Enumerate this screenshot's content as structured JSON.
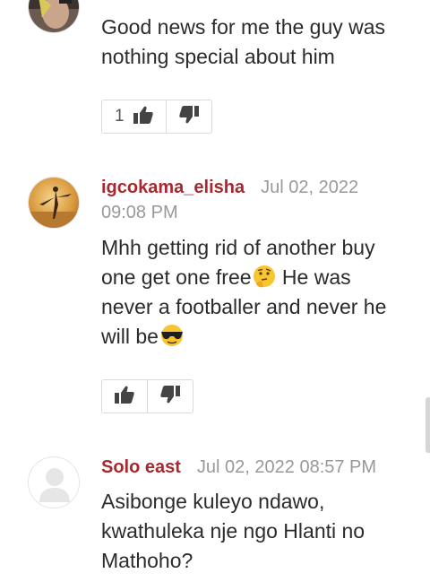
{
  "comments": [
    {
      "body": "Good news for me the guy was nothing special about him",
      "upvotes": "1"
    },
    {
      "username": "igcokama_elisha",
      "timestamp": "Jul 02, 2022 09:08 PM",
      "body_part1": "Mhh getting rid of another buy one get one free",
      "body_part2": " He was never a footballer and never he will be",
      "emoji1": "thinking-face",
      "emoji2": "sunglasses-face",
      "upvotes": ""
    },
    {
      "username": "Solo east",
      "timestamp": "Jul 02, 2022 08:57 PM",
      "body": "Asibonge kuleyo ndawo, kwathuleka nje ngo Hlanti no Mathoho?"
    }
  ],
  "colors": {
    "username": "#a8282f",
    "timestamp": "#999999",
    "text": "#2b2b2b",
    "border": "#d9d9d9"
  },
  "icons": {
    "upvote": "thumbs-up-icon",
    "downvote": "thumbs-down-icon"
  }
}
